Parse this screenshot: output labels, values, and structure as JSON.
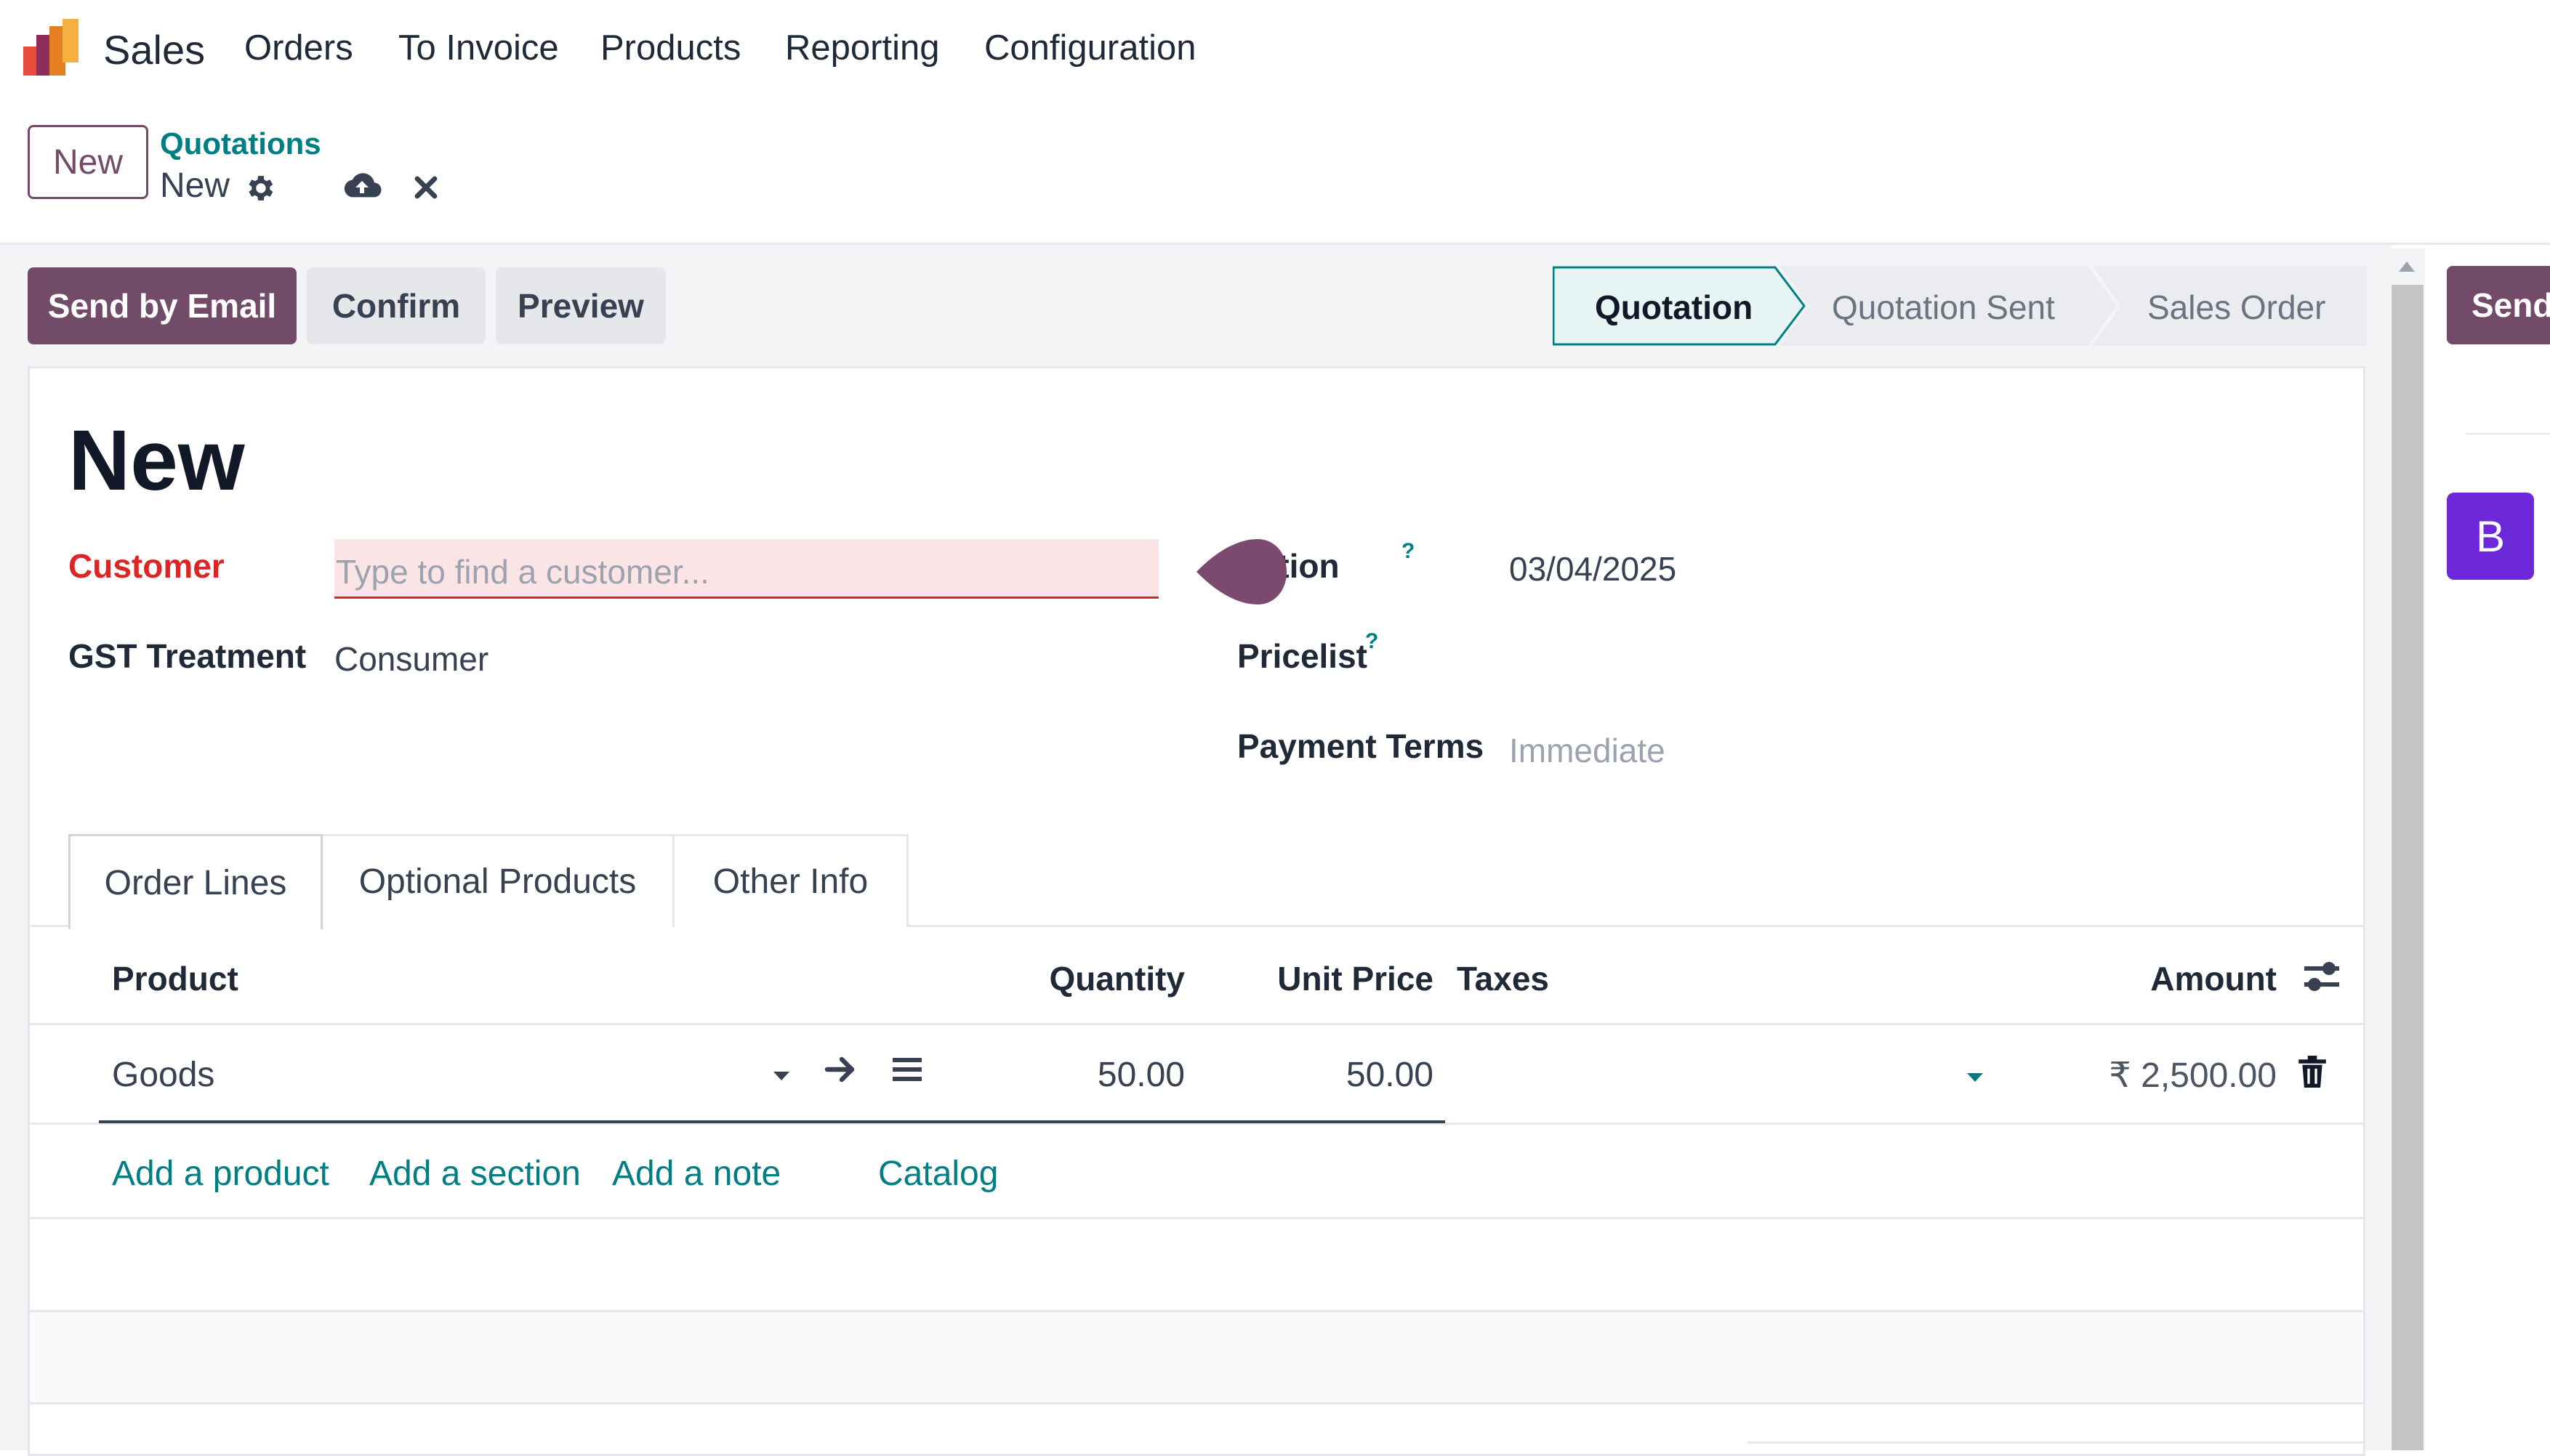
{
  "app": {
    "name": "Sales"
  },
  "navbar": {
    "items": [
      "Orders",
      "To Invoice",
      "Products",
      "Reporting",
      "Configuration"
    ]
  },
  "control_panel": {
    "new_label": "New",
    "breadcrumb_parent": "Quotations",
    "breadcrumb_current": "New"
  },
  "actions": {
    "send_email": "Send by Email",
    "confirm": "Confirm",
    "preview": "Preview"
  },
  "statusbar": {
    "stages": [
      "Quotation",
      "Quotation Sent",
      "Sales Order"
    ],
    "active": "Quotation"
  },
  "chatter": {
    "send_label": "Send",
    "avatar_letter": "B"
  },
  "form": {
    "title": "New",
    "customer_label": "Customer",
    "customer_placeholder": "Type to find a customer...",
    "customer_value": "",
    "gst_label": "GST Treatment",
    "gst_value": "Consumer",
    "expiration_label": "iration",
    "expiration_help": "?",
    "expiration_value": "03/04/2025",
    "pricelist_label": "Pricelist",
    "pricelist_help": "?",
    "payment_terms_label": "Payment Terms",
    "payment_terms_value": "Immediate"
  },
  "tabs": [
    "Order Lines",
    "Optional Products",
    "Other Info"
  ],
  "order_lines": {
    "columns": {
      "product": "Product",
      "quantity": "Quantity",
      "unit_price": "Unit Price",
      "taxes": "Taxes",
      "amount": "Amount"
    },
    "rows": [
      {
        "product": "Goods",
        "quantity": "50.00",
        "unit_price": "50.00",
        "taxes": "",
        "amount": "₹ 2,500.00"
      }
    ],
    "add_links": {
      "add_product": "Add a product",
      "add_section": "Add a section",
      "add_note": "Add a note",
      "catalog": "Catalog"
    }
  },
  "colors": {
    "primary": "#714b67",
    "link": "#017e84",
    "required": "#dc2626",
    "avatar": "#6d28d9",
    "active_stage_bg": "#e6f4f4"
  },
  "icons": [
    "app-logo-icon",
    "gear-icon",
    "cloud-upload-icon",
    "close-icon",
    "chevron-down-icon",
    "arrow-right-icon",
    "list-icon",
    "sliders-icon",
    "trash-icon",
    "chevron-up-icon"
  ]
}
